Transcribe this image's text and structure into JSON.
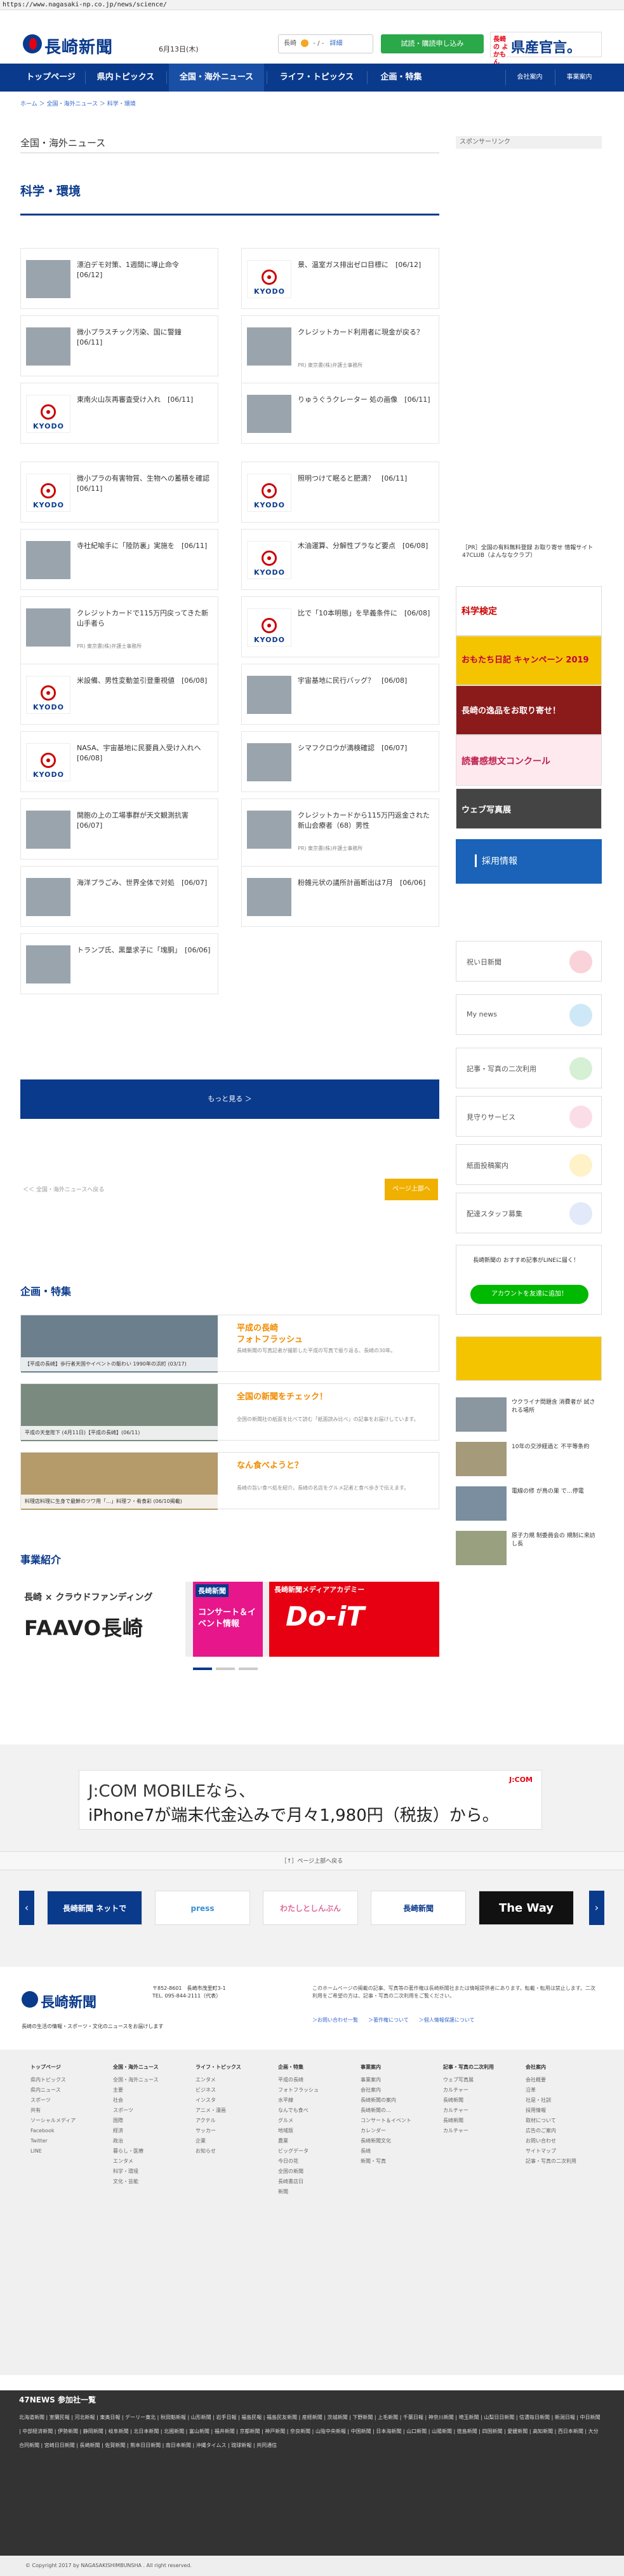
{
  "browser": {
    "url": "https://www.nagasaki-np.co.jp/news/science/"
  },
  "header": {
    "logo_text": "長崎新聞",
    "date": "6月13日(木)",
    "weather_text": "長崎",
    "weather_temp": "- / -",
    "weather_link": "詳細",
    "trial_button": "試読・購読申し込み",
    "ad_text": "県産官言。",
    "ad_logo": "長崎の よかもん"
  },
  "nav": {
    "items": [
      "トップページ",
      "県内トピックス",
      "全国・海外ニュース",
      "ライフ・トピックス",
      "企画・特集"
    ],
    "right": [
      "会社案内",
      "事業案内"
    ]
  },
  "breadcrumb": "ホーム ＞ 全国・海外ニュース ＞ 科学・環境",
  "main_title": "全国・海外ニュース",
  "section_title": "科学・環境",
  "sidebar": {
    "sponsor_label": "スポンサーリンク",
    "sponsor_text": "［PR］全国の有料無料登録 お取り寄せ 情報サイト47CLUB（よんななクラブ）",
    "recruit": "採用情報",
    "buttons": [
      "祝い日新聞",
      "My news",
      "記事・写真の二次利用",
      "見守りサービス",
      "紙面投稿案内",
      "配達スタッフ募集"
    ],
    "line_text": "長崎新聞の おすすめ記事がLINEに届く！",
    "line_button": "アカウントを友達に追加！",
    "news": [
      "ウクライナ問題含 消費者が 試される場所",
      "10年の交渉経過と 不平等条約",
      "電線の修 が鳥の巣 で…停電",
      "原子力規 制委員会の 規制に来訪し長"
    ],
    "ad_labels": [
      "科学検定",
      "おもたち日記 キャンペーン 2019",
      "長崎の逸品をお取り寄せ！",
      "読書感想文コンクール",
      "ウェブ写真展"
    ]
  },
  "cards": [
    {
      "title": "漂泊デモ対策、1週間に導止命令　[06/12]",
      "thumb": "photo",
      "pr": ""
    },
    {
      "title": "景、温室ガス排出ゼロ目標に　[06/12]",
      "thumb": "kyodo",
      "pr": ""
    },
    {
      "title": "微小プラスチック汚染、国に警鐘　[06/11]",
      "thumb": "photo",
      "pr": ""
    },
    {
      "title": "クレジットカード利用者に現金が戻る？",
      "thumb": "photo",
      "pr": "PR) 東京書(株)弁護士事務所"
    },
    {
      "title": "東南火山灰再審査受け入れ　[06/11]",
      "thumb": "kyodo",
      "pr": ""
    },
    {
      "title": "りゅうぐうクレーター 処の画像　[06/11]",
      "thumb": "photo",
      "pr": ""
    },
    {
      "title": "微小プラの有害物質、生物への蓄積を確認　[06/11]",
      "thumb": "kyodo",
      "pr": ""
    },
    {
      "title": "照明つけて眠ると肥満？　[06/11]",
      "thumb": "kyodo",
      "pr": ""
    },
    {
      "title": "寺社紀喩手に「陸防裏」実施を　[06/11]",
      "thumb": "photo",
      "pr": ""
    },
    {
      "title": "木油運算、分解性プラなど要点　[06/08]",
      "thumb": "kyodo",
      "pr": ""
    },
    {
      "title": "クレジットカードで115万円戻ってきた新山手者ら",
      "thumb": "photo",
      "pr": "PR) 東京書(株)弁護士事務所"
    },
    {
      "title": "比で「10本明態」を早義条件に　[06/08]",
      "thumb": "kyodo",
      "pr": ""
    },
    {
      "title": "米設備、男性変動並引登重視値　[06/08]",
      "thumb": "kyodo",
      "pr": ""
    },
    {
      "title": "宇宙基地に民行バッグ？　[06/08]",
      "thumb": "photo",
      "pr": ""
    },
    {
      "title": "NASA、宇宙基地に民要員入受け入れへ　[06/08]",
      "thumb": "kyodo",
      "pr": ""
    },
    {
      "title": "シマフクロウが満検確認　[06/07]",
      "thumb": "photo",
      "pr": ""
    },
    {
      "title": "開胞の上の工場事群が天文観測抗害　[06/07]",
      "thumb": "photo",
      "pr": ""
    },
    {
      "title": "クレジットカードから115万円返金された新山会療者（68）男性",
      "thumb": "photo",
      "pr": "PR) 東京書(株)弁護士事務所"
    },
    {
      "title": "海洋プラごみ、世界全体で対処　[06/07]",
      "thumb": "photo",
      "pr": ""
    },
    {
      "title": "粉雑元状の議所計画断出は7月　[06/06]",
      "thumb": "photo",
      "pr": ""
    },
    {
      "title": "トランプ氏、黒量求子に「塊胴」　[06/06]",
      "thumb": "photo",
      "pr": ""
    }
  ],
  "more_button": "もっと見る ＞",
  "page_back": "＜＜ 全国・海外ニュースへ戻る",
  "page_top": "ページ上部へ",
  "features": {
    "title": "企画・特集",
    "items": [
      {
        "head": "平成の長崎\nフォトフラッシュ",
        "desc": "長崎新聞の写真記者が撮影した平成の写真で振り返る、長崎の30年。",
        "cap": "【平成の長崎】歩行者天国やイベントの賑わい 1990年の浜町 (03/17)"
      },
      {
        "head": "全国の新聞をチェック！",
        "desc": "全国の新聞社の紙面を比べて読む「紙面読み比べ」の記事をお届けしています。",
        "cap": "平成の天皇陛下 (4月11日)【平成の長崎】(06/11)"
      },
      {
        "head": "なん食べようと？",
        "desc": "長崎の旨い食べ処を紹介。長崎の名店をグルメ記者と食べ歩きで伝えます。",
        "cap": "料理店料理に生身で最鮮のツワ用「…」料理フ・肴食彩 (06/10掲載)"
      }
    ]
  },
  "business": {
    "title": "事業紹介",
    "faavo_top": "長崎 × クラウドファンディング",
    "faavo_big": "FAAVO長崎",
    "concert_top": "長崎新聞",
    "concert_text": "コンサート＆イベント情報",
    "doit_top": "長崎新聞メディアアカデミー",
    "doit_big": "Do-iT"
  },
  "jcom": {
    "line1": "J:COM MOBILEなら、",
    "line2": "iPhone7が端末代金込みで月々1,980円（税抜）から。",
    "logo": "J:COM"
  },
  "page_up": "［↑］ページ上部へ戻る",
  "carousel": [
    "長崎新聞 ネットで",
    "press",
    "わたしとしんぶん",
    "長崎新聞",
    "The Way"
  ],
  "footer": {
    "logo_text": "長崎新聞",
    "address": "〒852-8601　長崎市茂里町3-1\nTEL. 095-844-2111（代表）",
    "tagline": "長崎の生活の情報・スポーツ・文化のニュースをお届けします",
    "notice": "このホームページの掲載の記事、写真等の著作権は長崎新聞社または情報提供者にあります。転載・転用は禁止します。二次利用をご希望の方は、記事・写真の二次利用をご覧ください。",
    "links": "＞お問い合わせ一覧　　＞著作権について　　＞個人情報保護について"
  },
  "sitemap": [
    {
      "head": "トップページ",
      "items": [
        "県内トピックス",
        "県内ニュース",
        "スポーツ",
        "共有",
        "ソーシャルメディア",
        "Facebook",
        "Twitter",
        "LINE"
      ]
    },
    {
      "head": "全国・海外ニュース",
      "items": [
        "全国・海外ニュース",
        "主要",
        "社会",
        "スポーツ",
        "国際",
        "経済",
        "政治",
        "暮らし・医療",
        "エンタメ",
        "科学・環境",
        "文化・芸能"
      ]
    },
    {
      "head": "ライフ・トピックス",
      "items": [
        "エンタメ",
        "ビジネス",
        "インスタ",
        "アニメ・漫画",
        "アクテル",
        "サッカー",
        "企業",
        "お知らせ"
      ]
    },
    {
      "head": "企画・特集",
      "items": [
        "平成の長崎",
        "フォトフラッシュ",
        "水平線",
        "なんでも食べ",
        "グルメ",
        "地域版",
        "農業",
        "ビッグデータ",
        "今日の花",
        "全国の新聞",
        "長崎書店日",
        "新聞"
      ]
    },
    {
      "head": "事業案内",
      "items": [
        "事業案内",
        "会社案内",
        "長崎新聞の案内",
        "長崎新聞の…",
        "コンサート＆イベント",
        "カレンダー",
        "長崎新聞文化",
        "長崎",
        "新聞・写真"
      ]
    },
    {
      "head": "記事・写真の二次利用",
      "items": [
        "ウェブ写真展",
        "カルチャー",
        "長崎新聞",
        "カルチャー",
        "長崎新聞",
        "カルチャー"
      ]
    },
    {
      "head": "会社案内",
      "items": [
        "会社概要",
        "沿革",
        "社是・社訓",
        "採用情報",
        "取材について",
        "広告のご案内",
        "お問い合わせ",
        "サイトマップ",
        "記事・写真の二次利用"
      ]
    }
  ],
  "news47": {
    "title": "47NEWS 参加社一覧",
    "list": "北海道新聞 | 室蘭民報 | 河北新報 | 東奥日報 | デーリー東北 | 秋田魁新報 | 山形新聞 | 岩手日報 | 福島民報 | 福島民友新聞 | 産経新聞 | 茨城新聞 | 下野新聞 | 上毛新聞 | 千葉日報 | 神奈川新聞 | 埼玉新聞 | 山梨日日新聞 | 信濃毎日新聞 | 新潟日報 | 中日新聞 | 中部経済新聞 | 伊勢新聞 | 静岡新聞 | 岐阜新聞 | 北日本新聞 | 北國新聞 | 富山新聞 | 福井新聞 | 京都新聞 | 神戸新聞 | 奈良新聞 | 山陰中央新報 | 中国新聞 | 日本海新聞 | 山口新聞 | 山陽新聞 | 徳島新聞 | 四国新聞 | 愛媛新聞 | 高知新聞 | 西日本新聞 | 大分合同新聞 | 宮崎日日新聞 | 長崎新聞 | 佐賀新聞 | 熊本日日新聞 | 南日本新聞 | 沖縄タイムス | 琉球新報 | 共同通信"
  },
  "copyright": "© Copyright 2017 by NAGASAKISHIMBUNSHA . All right reserved."
}
